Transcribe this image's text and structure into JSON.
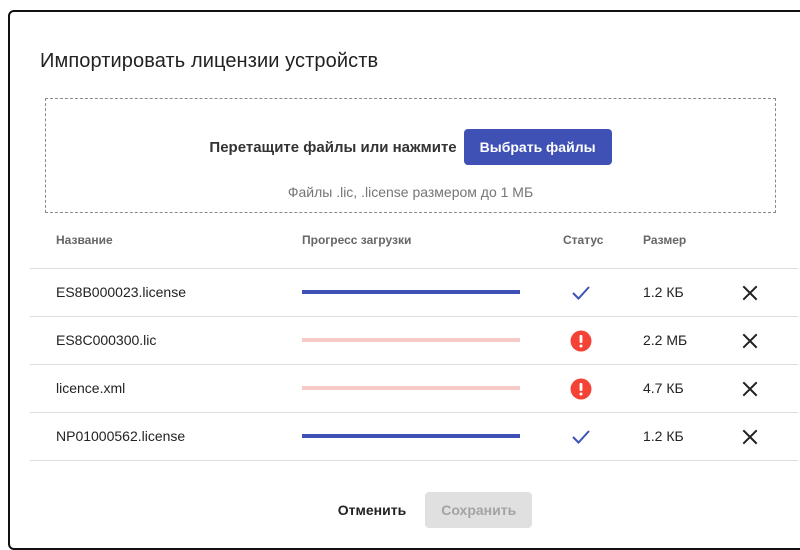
{
  "dialog": {
    "title": "Импортировать лицензии устройств"
  },
  "dropzone": {
    "prompt": "Перетащите файлы или нажмите",
    "choose_button": "Выбрать файлы",
    "hint": "Файлы .lic, .license размером до 1 МБ"
  },
  "table": {
    "columns": {
      "name": "Название",
      "progress": "Прогресс загрузки",
      "status": "Статус",
      "size": "Размер"
    },
    "rows": [
      {
        "name": "ES8B000023.license",
        "progress": 1.0,
        "status": "success",
        "status_icon": "check-icon",
        "size": "1.2 КБ"
      },
      {
        "name": "ES8C000300.lic",
        "progress": 0.0,
        "status": "error",
        "status_icon": "error-icon",
        "size": "2.2 МБ"
      },
      {
        "name": "licence.xml",
        "progress": 0.0,
        "status": "error",
        "status_icon": "error-icon",
        "size": "4.7 КБ"
      },
      {
        "name": "NP01000562.license",
        "progress": 1.0,
        "status": "success",
        "status_icon": "check-icon",
        "size": "1.2 КБ"
      }
    ]
  },
  "footer": {
    "cancel_label": "Отменить",
    "save_label": "Сохранить"
  },
  "colors": {
    "accent": "#3f51b5",
    "error": "#f44336",
    "progress_track": "#f6cbc7",
    "disabled_bg": "#e0e0e0"
  }
}
